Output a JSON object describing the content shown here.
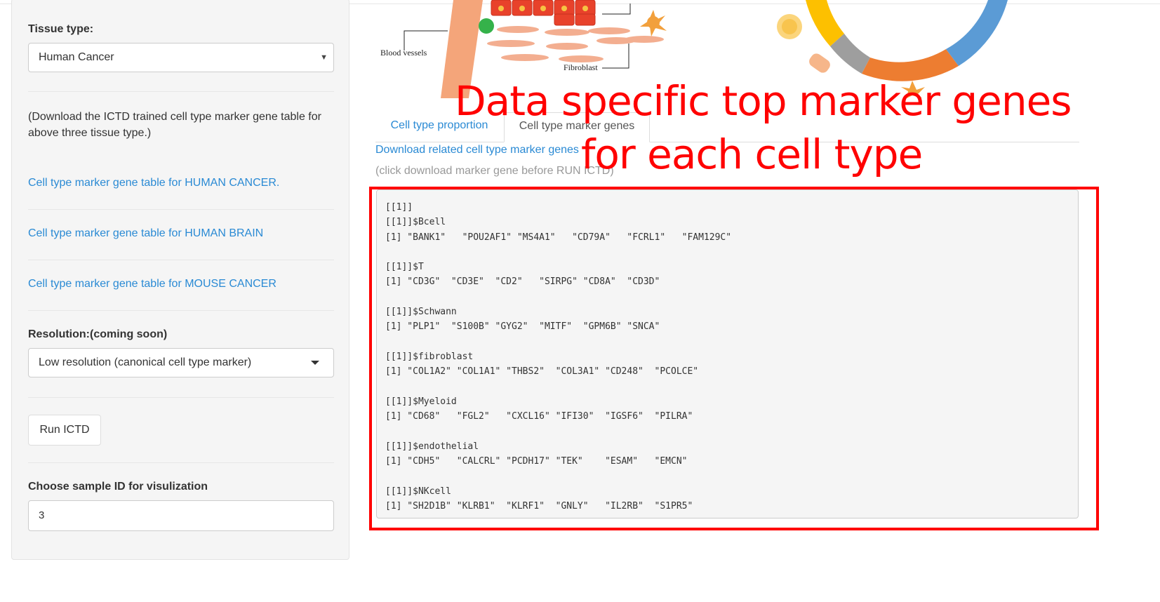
{
  "sidebar": {
    "tissue_label": "Tissue type:",
    "tissue_value": "Human Cancer",
    "download_note": "(Download the ICTD trained cell type marker gene table for above three tissue type.)",
    "links": [
      "Cell type marker gene table for HUMAN CANCER.",
      "Cell type marker gene table for HUMAN BRAIN",
      "Cell type marker gene table for MOUSE CANCER"
    ],
    "resolution_label": "Resolution:(coming soon)",
    "resolution_value": "Low resolution (canonical cell type marker)",
    "run_button": "Run ICTD",
    "sample_label": "Choose sample ID for visulization",
    "sample_value": "3"
  },
  "illustration": {
    "blood_vessels_label": "Blood vessels",
    "fibroblast_label": "Fibroblast"
  },
  "main": {
    "tabs": [
      "Cell type proportion",
      "Cell type marker genes"
    ],
    "active_tab": "Cell type marker genes",
    "download_link": "Download related cell type marker genes",
    "download_hint": "(click download marker gene before RUN ICTD)",
    "output_lines": [
      "[[1]]",
      "[[1]]$Bcell",
      "[1] \"BANK1\"   \"POU2AF1\" \"MS4A1\"   \"CD79A\"   \"FCRL1\"   \"FAM129C\"",
      "",
      "[[1]]$T",
      "[1] \"CD3G\"  \"CD3E\"  \"CD2\"   \"SIRPG\" \"CD8A\"  \"CD3D\"",
      "",
      "[[1]]$Schwann",
      "[1] \"PLP1\"  \"S100B\" \"GYG2\"  \"MITF\"  \"GPM6B\" \"SNCA\"",
      "",
      "[[1]]$fibroblast",
      "[1] \"COL1A2\" \"COL1A1\" \"THBS2\"  \"COL3A1\" \"CD248\"  \"PCOLCE\"",
      "",
      "[[1]]$Myeloid",
      "[1] \"CD68\"   \"FGL2\"   \"CXCL16\" \"IFI30\"  \"IGSF6\"  \"PILRA\"",
      "",
      "[[1]]$endothelial",
      "[1] \"CDH5\"   \"CALCRL\" \"PCDH17\" \"TEK\"    \"ESAM\"   \"EMCN\"",
      "",
      "[[1]]$NKcell",
      "[1] \"SH2D1B\" \"KLRB1\"  \"KLRF1\"  \"GNLY\"   \"IL2RB\"  \"S1PR5\""
    ]
  },
  "annotation": {
    "line1": "Data specific top marker genes",
    "line2": "for each cell type",
    "color": "#ff0000"
  },
  "colors": {
    "link": "#2a8ad4",
    "panel_bg": "#f5f5f5"
  }
}
